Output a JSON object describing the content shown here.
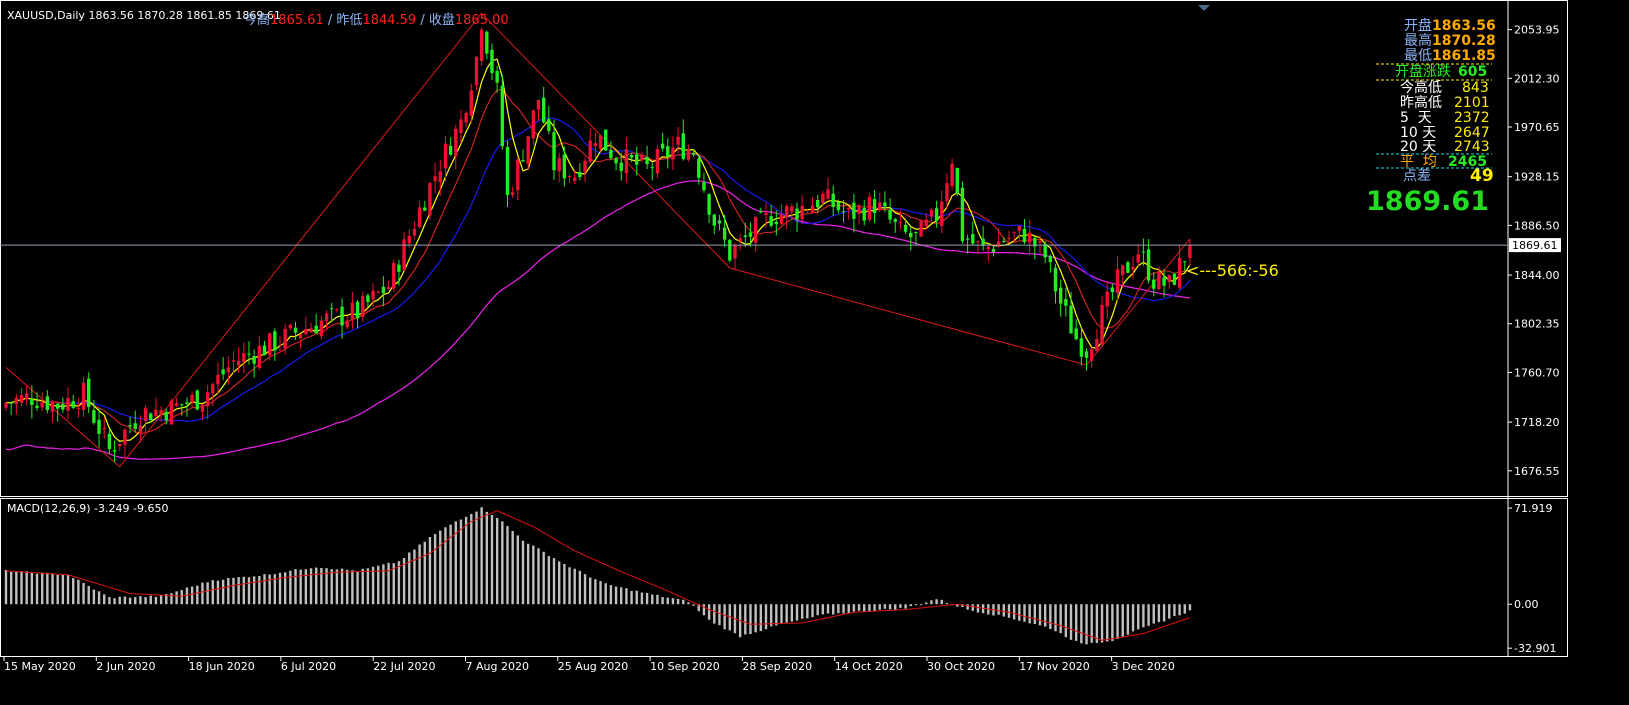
{
  "header": {
    "symbol_label": "XAUUSD,Daily  1863.56 1870.28 1861.85 1869.61",
    "overlay_prefix": "今高",
    "overlay_high_value": "1865.61",
    "overlay_prev_low_label": "/ 昨低",
    "overlay_prev_low_value": "1844.59",
    "overlay_close_label": "/ 收盘",
    "overlay_close_value": "1865.00"
  },
  "info_panel": {
    "open_label": "开盘",
    "open_value": "1863.56",
    "high_label": "最高",
    "high_value": "1870.28",
    "low_label": "最低",
    "low_value": "1861.85",
    "open_change_label": "开盘涨跌",
    "open_change_value": "605",
    "today_range_label": "今高低",
    "today_range_value": "843",
    "prev_range_label": "昨高低",
    "prev_range_value": "2101",
    "d5_label": "5  天",
    "d5_value": "2372",
    "d10_label": "10 天",
    "d10_value": "2647",
    "d20_label": "20 天",
    "d20_value": "2743",
    "avg_label": "平  均",
    "avg_value": "2465",
    "spread_label": "点差",
    "spread_value": "49",
    "big_price": "1869.61"
  },
  "annotation": {
    "arrow_text": "<---566:-56"
  },
  "macd_panel": {
    "label": "MACD(12,26,9) -3.249 -9.650"
  },
  "colors": {
    "background": "#000000",
    "bull": "#ee1133",
    "bear": "#22ee22",
    "ma_fast": "#ffff00",
    "ma_mid": "#cc2222",
    "ma_slow": "#1a1aee",
    "ma_long": "#ee22ee",
    "zigzag": "#dd1a1a",
    "macd_hist": "#c0c0c0",
    "macd_signal": "#dd1111",
    "grid_text": "#ffffff"
  },
  "chart_data": [
    {
      "type": "candlestick",
      "symbol": "XAUUSD",
      "timeframe": "Daily",
      "last_price": 1869.61,
      "ylim": [
        1655,
        2075
      ],
      "y_ticks": [
        "2053.95",
        "2012.30",
        "1970.65",
        "1928.15",
        "1886.50",
        "1844.00",
        "1802.35",
        "1760.70",
        "1718.20",
        "1676.55"
      ],
      "x_ticks": [
        "15 May 2020",
        "2 Jun 2020",
        "18 Jun 2020",
        "6 Jul 2020",
        "22 Jul 2020",
        "7 Aug 2020",
        "25 Aug 2020",
        "10 Sep 2020",
        "28 Sep 2020",
        "14 Oct 2020",
        "30 Oct 2020",
        "17 Nov 2020",
        "3 Dec 2020"
      ],
      "price_line": 1869.61,
      "price_line_label": "1869.61",
      "anchor_closes": [
        [
          0,
          1735
        ],
        [
          5,
          1740
        ],
        [
          10,
          1733
        ],
        [
          15,
          1742
        ],
        [
          20,
          1694
        ],
        [
          26,
          1726
        ],
        [
          32,
          1730
        ],
        [
          38,
          1740
        ],
        [
          44,
          1770
        ],
        [
          50,
          1782
        ],
        [
          56,
          1795
        ],
        [
          62,
          1806
        ],
        [
          68,
          1812
        ],
        [
          74,
          1835
        ],
        [
          80,
          1900
        ],
        [
          84,
          1940
        ],
        [
          88,
          1975
        ],
        [
          91,
          2030
        ],
        [
          92,
          2063
        ],
        [
          95,
          2000
        ],
        [
          97,
          1910
        ],
        [
          100,
          1950
        ],
        [
          103,
          1995
        ],
        [
          106,
          1938
        ],
        [
          110,
          1930
        ],
        [
          114,
          1965
        ],
        [
          118,
          1945
        ],
        [
          124,
          1935
        ],
        [
          130,
          1955
        ],
        [
          133,
          1950
        ],
        [
          137,
          1890
        ],
        [
          140,
          1862
        ],
        [
          143,
          1875
        ],
        [
          148,
          1895
        ],
        [
          153,
          1900
        ],
        [
          158,
          1910
        ],
        [
          163,
          1895
        ],
        [
          168,
          1905
        ],
        [
          173,
          1880
        ],
        [
          176,
          1875
        ],
        [
          180,
          1895
        ],
        [
          183,
          1945
        ],
        [
          185,
          1878
        ],
        [
          189,
          1865
        ],
        [
          193,
          1875
        ],
        [
          197,
          1880
        ],
        [
          201,
          1860
        ],
        [
          204,
          1820
        ],
        [
          207,
          1790
        ],
        [
          209,
          1780
        ],
        [
          212,
          1810
        ],
        [
          215,
          1838
        ],
        [
          219,
          1865
        ],
        [
          222,
          1840
        ],
        [
          225,
          1835
        ],
        [
          228,
          1860
        ],
        [
          229,
          1869.61
        ]
      ],
      "zigzag": [
        [
          0,
          1765
        ],
        [
          22,
          1680
        ],
        [
          92,
          2068
        ],
        [
          140,
          1850
        ],
        [
          209,
          1767
        ],
        [
          229,
          1875
        ]
      ],
      "moving_averages": [
        {
          "color": "yellow",
          "period": 5
        },
        {
          "color": "red",
          "period": 10
        },
        {
          "color": "blue",
          "period": 20
        },
        {
          "color": "magenta",
          "period": 50
        }
      ]
    },
    {
      "type": "bar",
      "name": "MACD(12,26,9)",
      "ylim": [
        -38,
        78
      ],
      "y_ticks": [
        "71.919",
        "0.00",
        "-32.901"
      ],
      "histogram_anchors": [
        [
          0,
          25
        ],
        [
          12,
          22
        ],
        [
          20,
          5
        ],
        [
          30,
          6
        ],
        [
          40,
          18
        ],
        [
          50,
          22
        ],
        [
          60,
          28
        ],
        [
          68,
          25
        ],
        [
          76,
          32
        ],
        [
          82,
          50
        ],
        [
          87,
          62
        ],
        [
          92,
          72
        ],
        [
          95,
          65
        ],
        [
          100,
          48
        ],
        [
          108,
          30
        ],
        [
          116,
          15
        ],
        [
          124,
          8
        ],
        [
          132,
          2
        ],
        [
          136,
          -12
        ],
        [
          142,
          -24
        ],
        [
          150,
          -15
        ],
        [
          158,
          -8
        ],
        [
          166,
          -5
        ],
        [
          174,
          -3
        ],
        [
          180,
          4
        ],
        [
          186,
          -4
        ],
        [
          194,
          -10
        ],
        [
          202,
          -18
        ],
        [
          208,
          -30
        ],
        [
          214,
          -27
        ],
        [
          220,
          -18
        ],
        [
          229,
          -5
        ]
      ],
      "signal_anchors": [
        [
          0,
          25
        ],
        [
          12,
          22
        ],
        [
          24,
          8
        ],
        [
          34,
          6
        ],
        [
          44,
          14
        ],
        [
          54,
          20
        ],
        [
          64,
          24
        ],
        [
          74,
          25
        ],
        [
          82,
          38
        ],
        [
          90,
          62
        ],
        [
          95,
          70
        ],
        [
          102,
          58
        ],
        [
          110,
          40
        ],
        [
          118,
          26
        ],
        [
          128,
          10
        ],
        [
          136,
          -4
        ],
        [
          144,
          -15
        ],
        [
          154,
          -14
        ],
        [
          164,
          -6
        ],
        [
          174,
          -4
        ],
        [
          184,
          0
        ],
        [
          194,
          -6
        ],
        [
          204,
          -16
        ],
        [
          212,
          -27
        ],
        [
          220,
          -22
        ],
        [
          229,
          -10
        ]
      ]
    }
  ]
}
